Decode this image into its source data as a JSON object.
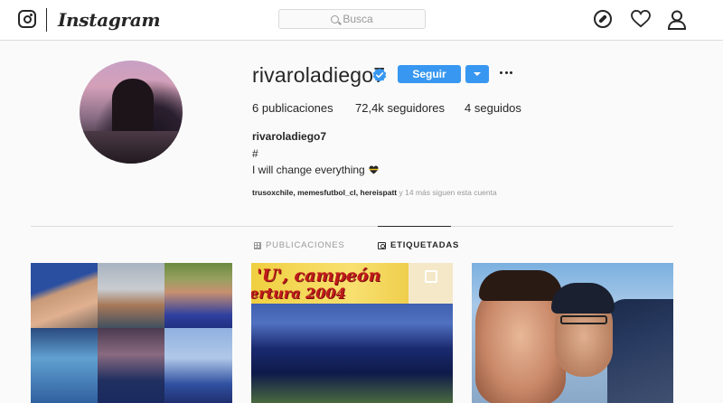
{
  "nav": {
    "wordmark": "Instagram",
    "search_placeholder": "Busca",
    "icons": [
      "instagram-logo-icon",
      "compass-icon",
      "heart-icon",
      "person-icon"
    ]
  },
  "profile": {
    "username": "rivaroladiego7",
    "verified": true,
    "follow_label": "Seguir",
    "posts_count": "6",
    "posts_label": "publicaciones",
    "followers_count": "72,4k",
    "followers_label": "seguidores",
    "following_count": "4",
    "following_label": "seguidos",
    "full_name": "rivaroladiego7",
    "bio_line1": "#",
    "bio_line2": "I will change everything",
    "followed_by_names": "trusoxchile, memesfutbol_cl, hereispatt",
    "followed_by_rest": "y 14 más siguen esta cuenta"
  },
  "tabs": {
    "posts_label": "PUBLICACIONES",
    "tagged_label": "ETIQUETADAS",
    "active": "tagged"
  },
  "grid": {
    "photo2_title": "'U', campeón",
    "photo2_subtitle": "ertura 2004"
  },
  "colors": {
    "accent": "#3897f0",
    "text": "#262626",
    "muted": "#999999",
    "border": "#dbdbdb",
    "background": "#fafafa"
  }
}
